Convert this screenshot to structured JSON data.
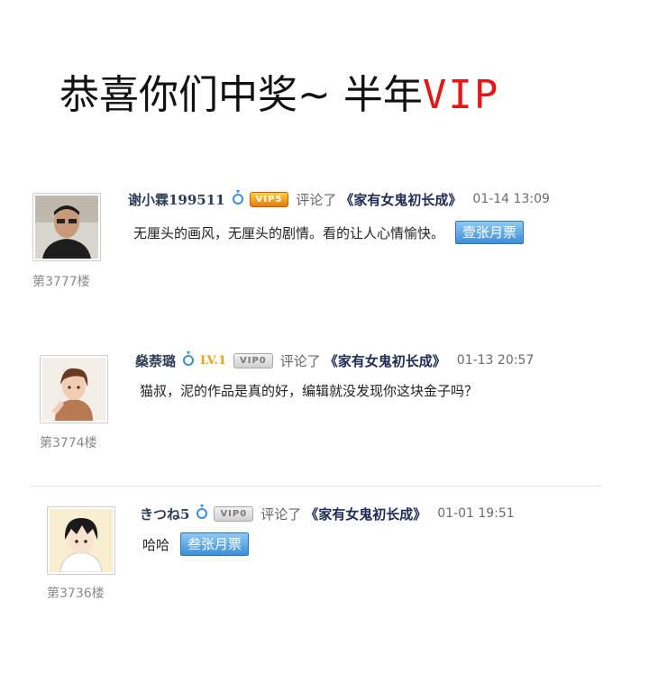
{
  "headline": {
    "main": "恭喜你们中奖~ 半年",
    "vip": "VIP"
  },
  "comments": [
    {
      "username": "谢小霖199511",
      "badge": "VIP5",
      "verb": "评论了",
      "book": "《家有女鬼初长成》",
      "time": "01-14 13:09",
      "text": "无厘头的画风，无厘头的剧情。看的让人心情愉快。",
      "ticket": "壹张月票",
      "floor": "第3777楼"
    },
    {
      "username": "燊萘璐",
      "level": "LV.1",
      "badge": "VIP0",
      "verb": "评论了",
      "book": "《家有女鬼初长成》",
      "time": "01-13 20:57",
      "text": "猫叔，泥的作品是真的好，编辑就没发现你这块金子吗？",
      "floor": "第3774楼"
    },
    {
      "username": "きつね5",
      "badge": "VIP0",
      "verb": "评论了",
      "book": "《家有女鬼初长成》",
      "time": "01-01 19:51",
      "text": "哈哈",
      "ticket": "叁张月票",
      "floor": "第3736楼"
    }
  ],
  "colors": {
    "vip_red": "#e01818",
    "ticket_blue": "#3d8fd8",
    "username": "#2f3e57"
  }
}
